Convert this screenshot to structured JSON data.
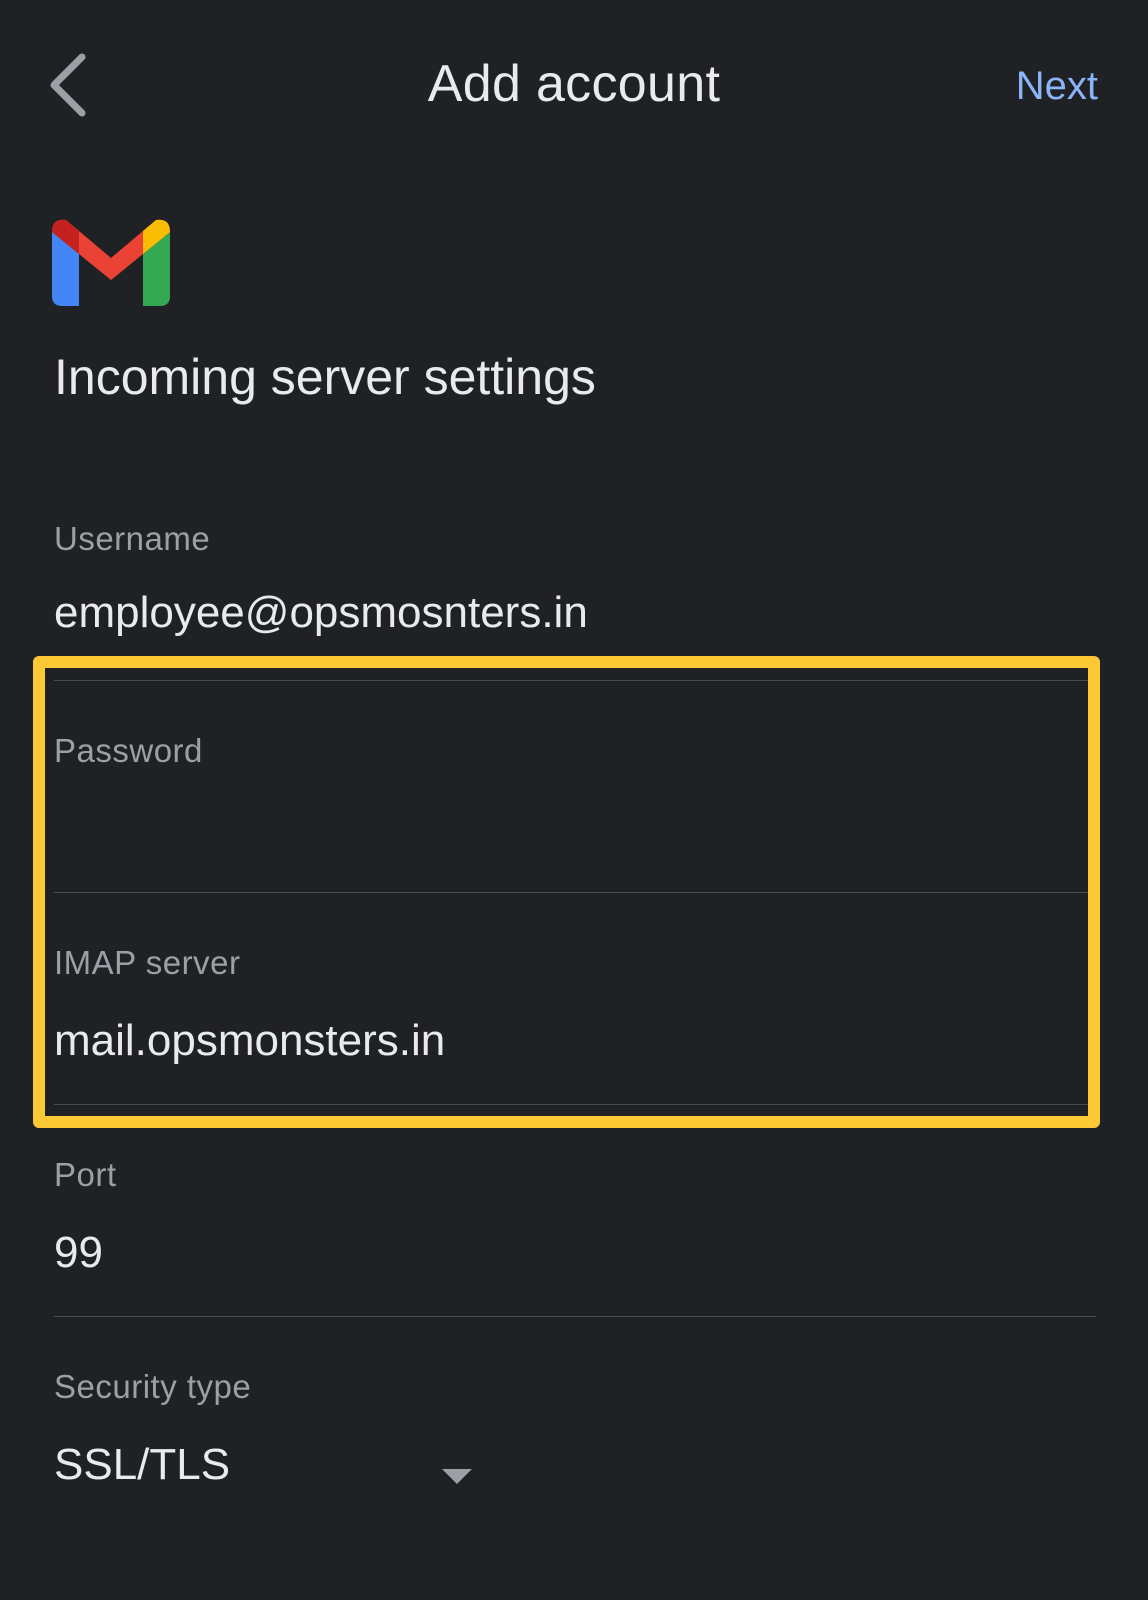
{
  "header": {
    "title": "Add account",
    "next_label": "Next"
  },
  "logo": {
    "name": "gmail-logo"
  },
  "section": {
    "title": "Incoming server settings"
  },
  "fields": {
    "username": {
      "label": "Username",
      "value": "employee@opsmosnters.in"
    },
    "password": {
      "label": "Password",
      "value": ""
    },
    "imap_server": {
      "label": "IMAP server",
      "value": "mail.opsmonsters.in"
    },
    "port": {
      "label": "Port",
      "value": "99"
    },
    "security_type": {
      "label": "Security type",
      "value": "SSL/TLS"
    }
  },
  "colors": {
    "background": "#202124",
    "accent": "#8ab4f8",
    "highlight": "#fcc934",
    "label": "#9aa0a6"
  }
}
